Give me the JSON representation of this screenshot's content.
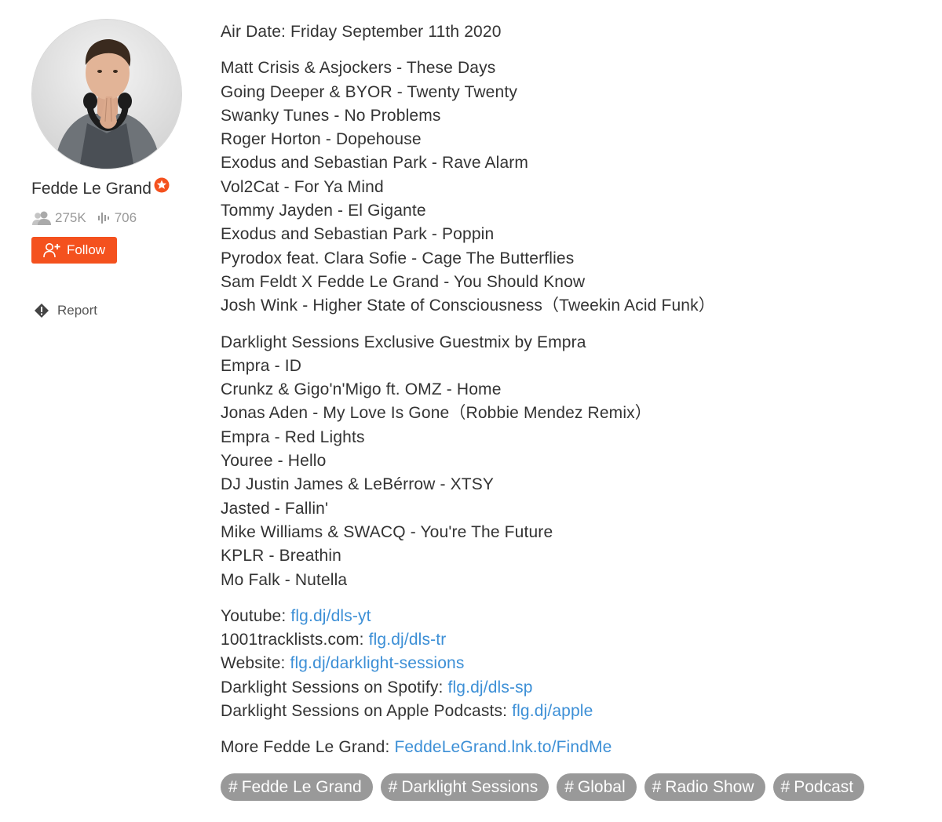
{
  "user": {
    "name": "Fedde Le Grand",
    "followers": "275K",
    "tracks": "706",
    "follow_label": "Follow",
    "report_label": "Report"
  },
  "description": {
    "air_date": "Air Date: Friday September 11th 2020",
    "tracklist": [
      "Matt Crisis & Asjockers - These Days",
      "Going Deeper & BYOR - Twenty Twenty",
      "Swanky Tunes - No Problems",
      "Roger Horton - Dopehouse",
      "Exodus and Sebastian Park - Rave Alarm",
      "Vol2Cat - For Ya Mind",
      "Tommy Jayden - El Gigante",
      "Exodus and Sebastian Park - Poppin",
      "Pyrodox feat. Clara Sofie - Cage The Butterflies",
      "Sam Feldt X Fedde Le Grand - You Should Know",
      "Josh Wink - Higher State of Consciousness（Tweekin Acid Funk）"
    ],
    "guestmix": [
      "Darklight Sessions Exclusive Guestmix by Empra",
      "Empra - ID",
      "Crunkz & Gigo'n'Migo ft. OMZ - Home",
      "Jonas Aden - My Love Is Gone（Robbie Mendez Remix）",
      "Empra - Red Lights",
      "Youree - Hello",
      "DJ Justin James & LeBérrow - XTSY",
      "Jasted - Fallin'",
      "Mike Williams & SWACQ - You're The Future",
      "KPLR - Breathin",
      "Mo Falk - Nutella"
    ],
    "links": [
      {
        "label": "Youtube: ",
        "url": "flg.dj/dls-yt"
      },
      {
        "label": "1001tracklists.com: ",
        "url": "flg.dj/dls-tr"
      },
      {
        "label": "Website: ",
        "url": "flg.dj/darklight-sessions"
      },
      {
        "label": "Darklight Sessions on Spotify: ",
        "url": "flg.dj/dls-sp"
      },
      {
        "label": "Darklight Sessions on Apple Podcasts: ",
        "url": "flg.dj/apple"
      }
    ],
    "more": {
      "label": "More Fedde Le Grand: ",
      "url": "FeddeLeGrand.lnk.to/FindMe"
    }
  },
  "tags": [
    "Fedde Le Grand",
    "Darklight Sessions",
    "Global",
    "Radio Show",
    "Podcast"
  ],
  "colors": {
    "accent": "#f4511e",
    "link": "#3c8fd6",
    "tag_bg": "#999999",
    "muted": "#999999"
  },
  "icons": {
    "followers": "users-icon",
    "tracks": "soundwave-icon",
    "follow": "user-plus-icon",
    "report": "flag-diamond-icon",
    "pro": "pro-star-badge-icon"
  }
}
